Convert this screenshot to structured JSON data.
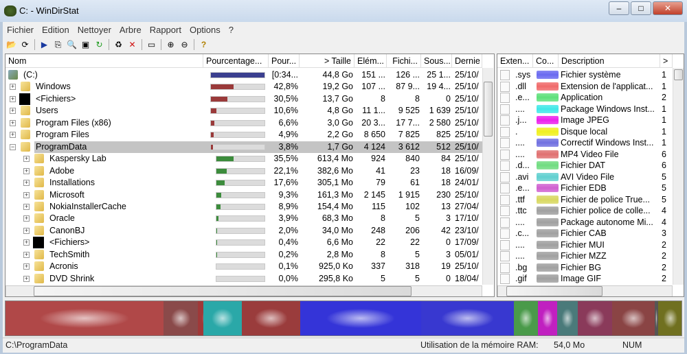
{
  "window": {
    "title": "C: - WinDirStat",
    "buttons": [
      "–",
      "□",
      "✕"
    ]
  },
  "menu": [
    "Fichier",
    "Edition",
    "Nettoyer",
    "Arbre",
    "Rapport",
    "Options",
    "?"
  ],
  "toolbar": [
    {
      "icon": "open-folder-icon",
      "glyph": "📂"
    },
    {
      "icon": "refresh-all-icon",
      "glyph": "⟳"
    },
    "sep",
    {
      "icon": "play-icon",
      "glyph": "▶"
    },
    {
      "icon": "copy-icon",
      "glyph": "⎘"
    },
    {
      "icon": "explorer-icon",
      "glyph": "🔍"
    },
    {
      "icon": "command-prompt-icon",
      "glyph": "▣"
    },
    {
      "icon": "refresh-icon",
      "glyph": "↻"
    },
    "sep",
    {
      "icon": "recycle-bin-icon",
      "glyph": "♻"
    },
    {
      "icon": "delete-icon",
      "glyph": "✕"
    },
    "sep",
    {
      "icon": "properties-icon",
      "glyph": "▭"
    },
    "sep",
    {
      "icon": "zoom-in-icon",
      "glyph": "⊕"
    },
    {
      "icon": "zoom-out-icon",
      "glyph": "⊖"
    },
    "sep",
    {
      "icon": "help-icon",
      "glyph": "?"
    }
  ],
  "tree": {
    "columns": [
      "Nom",
      "Pourcentage...",
      "Pour...",
      "> Taille",
      "Elém...",
      "Fichi...",
      "Sous...",
      "Dernie"
    ],
    "rows": [
      {
        "level": 0,
        "type": "drive",
        "name": "(C:)",
        "fill": 1.0,
        "pct": "[0:34...",
        "size": "44,8 Go",
        "items": "151 ...",
        "files": "126 ...",
        "subdirs": "25 1...",
        "date": "25/10/"
      },
      {
        "level": 1,
        "type": "folder",
        "name": "Windows",
        "fill": 0.428,
        "pct": "42,8%",
        "size": "19,2 Go",
        "items": "107 ...",
        "files": "87 9...",
        "subdirs": "19 4...",
        "date": "25/10/"
      },
      {
        "level": 1,
        "type": "files",
        "name": "<Fichiers>",
        "fill": 0.305,
        "pct": "30,5%",
        "size": "13,7 Go",
        "items": "8",
        "files": "8",
        "subdirs": "0",
        "date": "25/10/"
      },
      {
        "level": 1,
        "type": "folder",
        "name": "Users",
        "fill": 0.106,
        "pct": "10,6%",
        "size": "4,8 Go",
        "items": "11 1...",
        "files": "9 525",
        "subdirs": "1 639",
        "date": "25/10/"
      },
      {
        "level": 1,
        "type": "folder",
        "name": "Program Files (x86)",
        "fill": 0.066,
        "pct": "6,6%",
        "size": "3,0 Go",
        "items": "20 3...",
        "files": "17 7...",
        "subdirs": "2 580",
        "date": "25/10/"
      },
      {
        "level": 1,
        "type": "folder",
        "name": "Program Files",
        "fill": 0.049,
        "pct": "4,9%",
        "size": "2,2 Go",
        "items": "8 650",
        "files": "7 825",
        "subdirs": "825",
        "date": "25/10/"
      },
      {
        "level": 1,
        "type": "folder",
        "name": "ProgramData",
        "fill": 0.038,
        "pct": "3,8%",
        "size": "1,7 Go",
        "items": "4 124",
        "files": "3 612",
        "subdirs": "512",
        "date": "25/10/",
        "selected": true,
        "expanded": true
      },
      {
        "level": 2,
        "type": "folder",
        "name": "Kaspersky Lab",
        "fill": 0.355,
        "pct": "35,5%",
        "size": "613,4 Mo",
        "items": "924",
        "files": "840",
        "subdirs": "84",
        "date": "25/10/"
      },
      {
        "level": 2,
        "type": "folder",
        "name": "Adobe",
        "fill": 0.221,
        "pct": "22,1%",
        "size": "382,6 Mo",
        "items": "41",
        "files": "23",
        "subdirs": "18",
        "date": "16/09/"
      },
      {
        "level": 2,
        "type": "folder",
        "name": "Installations",
        "fill": 0.176,
        "pct": "17,6%",
        "size": "305,1 Mo",
        "items": "79",
        "files": "61",
        "subdirs": "18",
        "date": "24/01/"
      },
      {
        "level": 2,
        "type": "folder",
        "name": "Microsoft",
        "fill": 0.093,
        "pct": "9,3%",
        "size": "161,3 Mo",
        "items": "2 145",
        "files": "1 915",
        "subdirs": "230",
        "date": "25/10/"
      },
      {
        "level": 2,
        "type": "folder",
        "name": "NokiaInstallerCache",
        "fill": 0.089,
        "pct": "8,9%",
        "size": "154,4 Mo",
        "items": "115",
        "files": "102",
        "subdirs": "13",
        "date": "27/04/"
      },
      {
        "level": 2,
        "type": "folder",
        "name": "Oracle",
        "fill": 0.039,
        "pct": "3,9%",
        "size": "68,3 Mo",
        "items": "8",
        "files": "5",
        "subdirs": "3",
        "date": "17/10/"
      },
      {
        "level": 2,
        "type": "folder",
        "name": "CanonBJ",
        "fill": 0.02,
        "pct": "2,0%",
        "size": "34,0 Mo",
        "items": "248",
        "files": "206",
        "subdirs": "42",
        "date": "23/10/"
      },
      {
        "level": 2,
        "type": "files",
        "name": "<Fichiers>",
        "fill": 0.004,
        "pct": "0,4%",
        "size": "6,6 Mo",
        "items": "22",
        "files": "22",
        "subdirs": "0",
        "date": "17/09/"
      },
      {
        "level": 2,
        "type": "folder",
        "name": "TechSmith",
        "fill": 0.002,
        "pct": "0,2%",
        "size": "2,8 Mo",
        "items": "8",
        "files": "5",
        "subdirs": "3",
        "date": "05/01/"
      },
      {
        "level": 2,
        "type": "folder",
        "name": "Acronis",
        "fill": 0.001,
        "pct": "0,1%",
        "size": "925,0 Ko",
        "items": "337",
        "files": "318",
        "subdirs": "19",
        "date": "25/10/"
      },
      {
        "level": 2,
        "type": "folder",
        "name": "DVD Shrink",
        "fill": 0.0,
        "pct": "0,0%",
        "size": "295,8 Ko",
        "items": "5",
        "files": "5",
        "subdirs": "0",
        "date": "18/04/"
      }
    ],
    "bar_colors": {
      "root": "#3b3f8f",
      "level1": "#9a3a3a",
      "level2": "#3c8c3c"
    }
  },
  "extensions": {
    "columns": [
      "Exten...",
      "Co...",
      "Description",
      ">"
    ],
    "rows": [
      {
        "ext": ".sys",
        "color": "#6a6af0",
        "desc": "Fichier système",
        "size": "1"
      },
      {
        "ext": ".dll",
        "color": "#f06a6a",
        "desc": "Extension de l'applicat...",
        "size": "1"
      },
      {
        "ext": ".e...",
        "color": "#5ee07a",
        "desc": "Application",
        "size": "2"
      },
      {
        "ext": "....",
        "color": "#40e8e8",
        "desc": "Package Windows Inst...",
        "size": "1"
      },
      {
        "ext": ".j...",
        "color": "#ec20ec",
        "desc": "Image JPEG",
        "size": "1"
      },
      {
        "ext": ".",
        "color": "#f0f020",
        "desc": "Disque local",
        "size": "1"
      },
      {
        "ext": "....",
        "color": "#7070e0",
        "desc": "Correctif Windows Inst...",
        "size": "1"
      },
      {
        "ext": "....",
        "color": "#e07070",
        "desc": "MP4 Video File",
        "size": "6"
      },
      {
        "ext": ".d...",
        "color": "#70dc80",
        "desc": "Fichier DAT",
        "size": "6"
      },
      {
        "ext": ".avi",
        "color": "#60d0d0",
        "desc": "AVI Video File",
        "size": "5"
      },
      {
        "ext": ".e...",
        "color": "#d060d0",
        "desc": "Fichier EDB",
        "size": "5"
      },
      {
        "ext": ".ttf",
        "color": "#d8d860",
        "desc": "Fichier de police True...",
        "size": "5"
      },
      {
        "ext": ".ttc",
        "color": "#a0a0a0",
        "desc": "Fichier police de colle...",
        "size": "4"
      },
      {
        "ext": "....",
        "color": "#a0a0a0",
        "desc": "Package autonome Mi...",
        "size": "4"
      },
      {
        "ext": ".c...",
        "color": "#a0a0a0",
        "desc": "Fichier CAB",
        "size": "3"
      },
      {
        "ext": "....",
        "color": "#a0a0a0",
        "desc": "Fichier MUI",
        "size": "2"
      },
      {
        "ext": "....",
        "color": "#a0a0a0",
        "desc": "Fichier MZZ",
        "size": "2"
      },
      {
        "ext": ".bg",
        "color": "#a0a0a0",
        "desc": "Fichier BG",
        "size": "2"
      },
      {
        "ext": ".gif",
        "color": "#a0a0a0",
        "desc": "Image GIF",
        "size": "2"
      }
    ]
  },
  "status": {
    "path": "C:\\ProgramData",
    "ram_label": "Utilisation de la mémoire RAM:",
    "ram_value": "54,0 Mo",
    "num": "NUM"
  }
}
